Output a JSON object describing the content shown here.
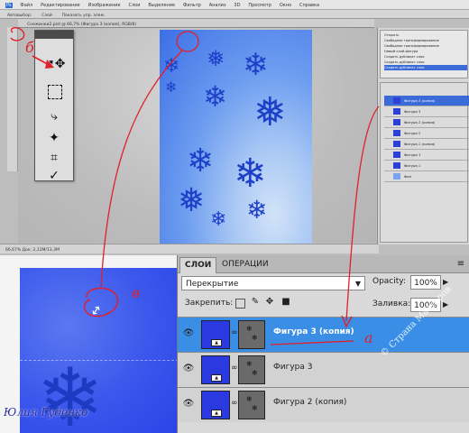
{
  "top_screenshot": {
    "menu": [
      "Файл",
      "Редактирование",
      "Изображение",
      "Слои",
      "Выделение",
      "Фильтр",
      "Анализ",
      "3D",
      "Просмотр",
      "Окно",
      "Справка"
    ],
    "options_bar": [
      "Автовыбор:",
      "Слой",
      "Показать упр. элем."
    ],
    "doc_tab": "Снежинки2.psd @ 66,7% (Фигура 3 (копия), RGB/8)",
    "status": "66,67%   Док: 2,11M/13,3M"
  },
  "history_items": [
    "Открыть",
    "Свободное трансформирование",
    "Свободное трансформирование",
    "Новый слой-фигура",
    "Создать дубликат слоя",
    "Создать дубликат слоя",
    "Создать дубликат слоя"
  ],
  "mini_layers": [
    "Фигура 3 (копия)",
    "Фигура 3",
    "Фигура 2 (копия)",
    "Фигура 2",
    "Фигура 1 (копия)",
    "Фигура 1",
    "Фигура 1",
    "Фон"
  ],
  "layers_panel": {
    "tabs": [
      "СЛОИ",
      "ОПЕРАЦИИ"
    ],
    "blend_mode": "Перекрытие",
    "opacity_label": "Opacity:",
    "opacity_value": "100%",
    "lock_label": "Закрепить:",
    "fill_label": "Заливка:",
    "fill_value": "100%",
    "layers": [
      {
        "name": "Фигура 3 (копия)",
        "selected": true
      },
      {
        "name": "Фигура 3",
        "selected": false
      },
      {
        "name": "Фигура 2 (копия)",
        "selected": false
      }
    ]
  },
  "annotations": {
    "b": "б",
    "v": "в",
    "a": "а",
    "author": "Юлия Гуденко"
  },
  "watermark": "© Страна Мастеров",
  "colors": {
    "accent_selected": "#3b8ee6",
    "annotation_red": "#e0202a",
    "snowflake": "#1e3fc8"
  }
}
